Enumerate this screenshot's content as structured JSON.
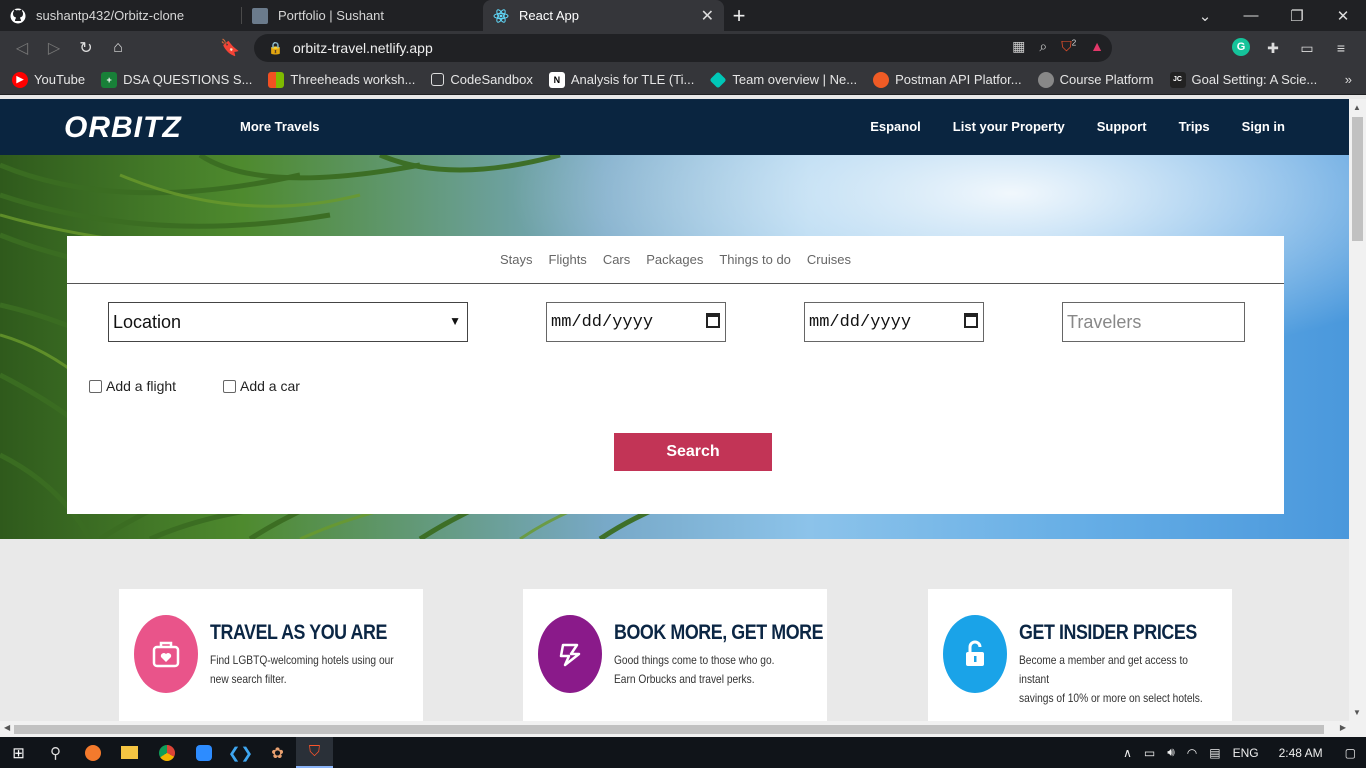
{
  "browser": {
    "tabs": [
      {
        "title": "sushantp432/Orbitz-clone",
        "icon": "github-icon"
      },
      {
        "title": "Portfolio | Sushant",
        "icon": "portfolio-icon"
      },
      {
        "title": "React App",
        "icon": "react-icon",
        "active": true
      }
    ],
    "url": "orbitz-travel.netlify.app",
    "extension_badge": "2",
    "bookmarks": [
      {
        "label": "YouTube",
        "color": "#ff0000"
      },
      {
        "label": "DSA QUESTIONS S...",
        "color": "#188038"
      },
      {
        "label": "Threeheads worksh...",
        "color": "#f25022"
      },
      {
        "label": "CodeSandbox",
        "color": "#333333"
      },
      {
        "label": "Analysis for TLE (Ti...",
        "color": "#555555"
      },
      {
        "label": "Team overview | Ne...",
        "color": "#00c7b7"
      },
      {
        "label": "Postman API Platfor...",
        "color": "#ef5b25"
      },
      {
        "label": "Course Platform",
        "color": "#888888"
      },
      {
        "label": "Goal Setting: A Scie...",
        "color": "#222222"
      }
    ]
  },
  "site": {
    "logo": "ORBITZ",
    "more_travels": "More Travels",
    "nav": [
      "Espanol",
      "List your Property",
      "Support",
      "Trips",
      "Sign in"
    ]
  },
  "search": {
    "tabs": [
      "Stays",
      "Flights",
      "Cars",
      "Packages",
      "Things to do",
      "Cruises"
    ],
    "location": "Location",
    "checkin_placeholder": "mm/dd/yyyy",
    "checkout_placeholder": "mm/dd/yyyy",
    "travelers_placeholder": "Travelers",
    "add_flight": "Add a flight",
    "add_car": "Add a car",
    "button": "Search",
    "button_color": "#c23456"
  },
  "promos": [
    {
      "title": "TRAVEL AS YOU ARE",
      "desc1": "Find LGBTQ-welcoming hotels using our",
      "desc2": "new search filter.",
      "color": "#e9548a",
      "icon": "suitcase-heart-icon"
    },
    {
      "title": "BOOK MORE, GET MORE",
      "desc1": "Good things come to those who go.",
      "desc2": "Earn Orbucks and travel perks.",
      "color": "#8a1a8a",
      "icon": "orbucks-icon"
    },
    {
      "title": "GET INSIDER PRICES",
      "desc1": "Become a member and get access to instant",
      "desc2": "savings of 10% or more on select hotels.",
      "color": "#1aa3e8",
      "icon": "unlock-icon"
    }
  ],
  "taskbar": {
    "language": "ENG",
    "time": "2:48 AM"
  }
}
